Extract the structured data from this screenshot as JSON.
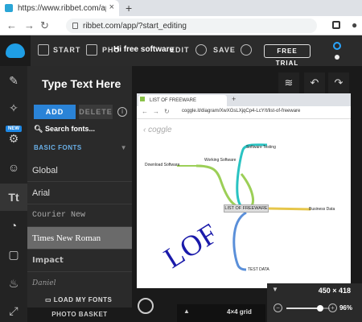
{
  "browser": {
    "tab_title": "https://www.ribbet.com/app/?st",
    "tab_close": "×",
    "new_tab": "+",
    "url": "ribbet.com/app/?start_editing"
  },
  "app_bar": {
    "start": "START",
    "photo": "PHO",
    "center_title": "Hi free software",
    "edit": "EDIT",
    "save": "SAVE",
    "free_trial": "FREE TRIAL"
  },
  "rail": {
    "new_badge": "NEW",
    "icons": [
      "brush-icon",
      "magic-wand-icon",
      "sticker-icon",
      "touchup-icon",
      "text-icon",
      "overlay-icon",
      "frame-icon",
      "texture-icon",
      "collage-icon"
    ]
  },
  "text_panel": {
    "title": "Type Text Here",
    "add_label": "ADD",
    "delete_label": "DELETE",
    "info": "i",
    "search_label": "Search fonts...",
    "category": "BASIC FONTS",
    "fonts": [
      "Global",
      "Arial",
      "Courier New",
      "Times New Roman",
      "Impact",
      "Daniel"
    ],
    "selected_font": "Times New Roman",
    "load_my_fonts": "LOAD MY FONTS",
    "photo_basket": "PHOTO BASKET"
  },
  "canvas": {
    "photo": {
      "tab_title": "LIST OF FREEWARE",
      "url": "coggle.it/diagram/XwXGsLXjqCp4-LcY/t/list-of-freeware",
      "coggle": "‹ coggle",
      "center_node": "LIST OF FREEWARE",
      "nodes": [
        "Software Testing",
        "Working Software",
        "Download Software",
        "Business Data",
        "TEST DATA"
      ],
      "overlay_text": "LOF"
    },
    "grid_label": "4×4 grid",
    "size": "450 × 418",
    "zoom": "96%",
    "zoom_fraction": 0.78
  }
}
